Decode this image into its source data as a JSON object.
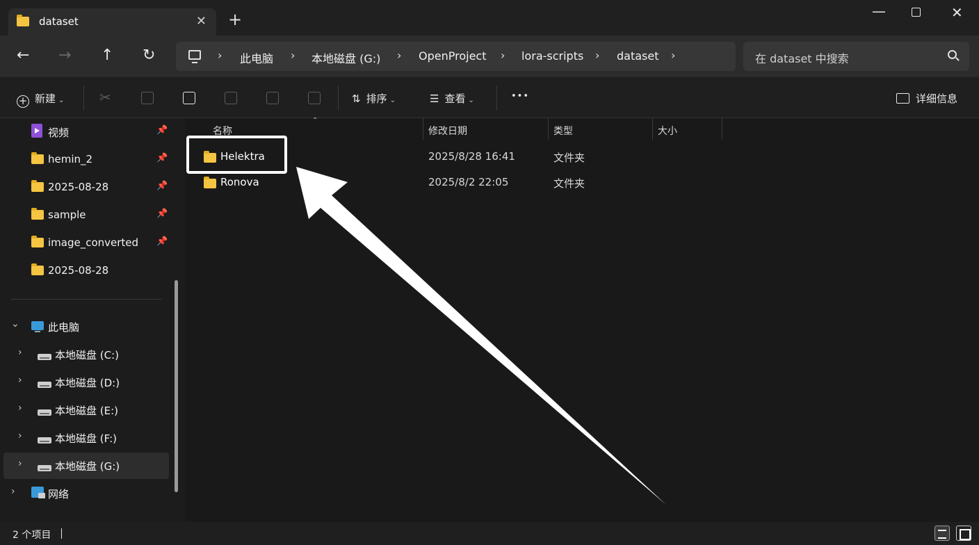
{
  "window": {
    "tab_title": "dataset",
    "tab_close": "✕",
    "new_tab": "+",
    "minimize": "—",
    "close": "✕"
  },
  "nav": {
    "back": "←",
    "forward": "→",
    "up": "↑",
    "refresh": "↻"
  },
  "breadcrumb": [
    "此电脑",
    "本地磁盘 (G:)",
    "OpenProject",
    "lora-scripts",
    "dataset"
  ],
  "breadcrumb_separator": "›",
  "search": {
    "placeholder": "在 dataset 中搜索"
  },
  "toolbar": {
    "new_label": "新建",
    "sort_label": "排序",
    "view_label": "查看",
    "more_label": "•••",
    "details_label": "详细信息"
  },
  "sidebar": {
    "quick_access": [
      {
        "label": "视频",
        "icon": "video-icon",
        "pinned": true
      },
      {
        "label": "hemin_2",
        "icon": "folder-icon",
        "pinned": true
      },
      {
        "label": "2025-08-28",
        "icon": "folder-icon",
        "pinned": true
      },
      {
        "label": "sample",
        "icon": "folder-icon",
        "pinned": true
      },
      {
        "label": "image_converted",
        "icon": "folder-icon",
        "pinned": true
      },
      {
        "label": "2025-08-28",
        "icon": "folder-icon",
        "pinned": false
      }
    ],
    "this_pc": "此电脑",
    "drives": [
      {
        "label": "本地磁盘 (C:)"
      },
      {
        "label": "本地磁盘 (D:)"
      },
      {
        "label": "本地磁盘 (E:)"
      },
      {
        "label": "本地磁盘 (F:)"
      },
      {
        "label": "本地磁盘 (G:)",
        "selected": true
      }
    ],
    "network": "网络"
  },
  "columns": {
    "name": "名称",
    "modified": "修改日期",
    "type": "类型",
    "size": "大小"
  },
  "files": [
    {
      "name": "Helektra",
      "modified": "2025/8/28 16:41",
      "type": "文件夹"
    },
    {
      "name": "Ronova",
      "modified": "2025/8/2 22:05",
      "type": "文件夹"
    }
  ],
  "status": {
    "item_count": "2 个项目"
  },
  "colors": {
    "background": "#191919",
    "folder": "#f4c542",
    "accent": "#3a9ad9",
    "annotation": "#ffffff"
  }
}
